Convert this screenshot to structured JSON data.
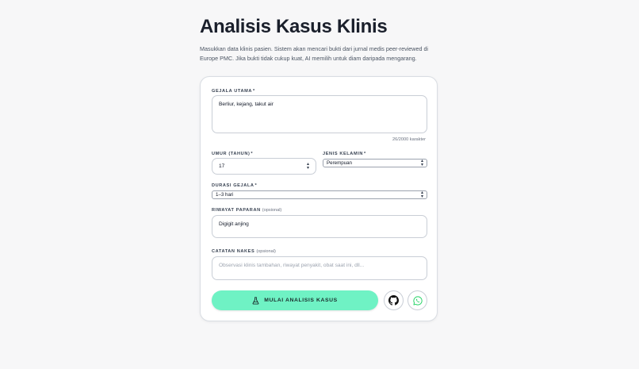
{
  "header": {
    "title": "Analisis Kasus Klinis",
    "subtitle": "Masukkan data klinis pasien. Sistem akan mencari bukti dari jurnal medis peer-reviewed di Europe PMC. Jika bukti tidak cukup kuat, AI memilih untuk diam daripada mengarang."
  },
  "form": {
    "symptoms": {
      "label": "GEJALA UTAMA",
      "required": "*",
      "value": "Berliur, kejang, takut air",
      "counter": "26/2000 karakter"
    },
    "age": {
      "label": "UMUR (TAHUN)",
      "required": "*",
      "value": "17"
    },
    "sex": {
      "label": "JENIS KELAMIN",
      "required": "*",
      "selected": "Perempuan"
    },
    "duration": {
      "label": "DURASI GEJALA",
      "required": "*",
      "selected": "1–3 hari"
    },
    "exposure": {
      "label": "RIWAYAT PAPARAN",
      "optional": "(opsional)",
      "value": "Digigit anjing"
    },
    "notes": {
      "label": "CATATAN NAKES",
      "optional": "(opsional)",
      "placeholder": "Observasi klinis tambahan, riwayat penyakit, obat saat ini, dll..."
    },
    "submit_label": "MULAI ANALISIS KASUS"
  },
  "icons": {
    "submit": "flask-icon",
    "github": "github-icon",
    "whatsapp": "whatsapp-icon"
  },
  "colors": {
    "accent": "#6ff2c4",
    "whatsapp": "#25d366",
    "background": "#f7f7f8"
  }
}
